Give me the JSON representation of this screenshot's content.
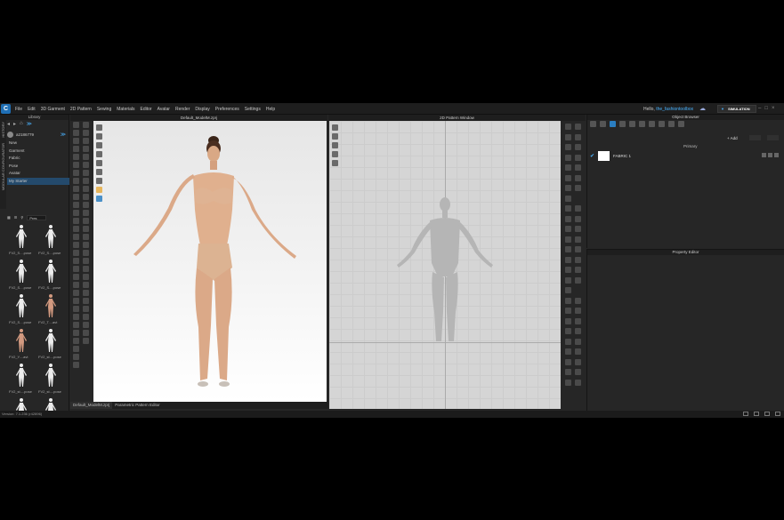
{
  "app": {
    "menu": [
      "File",
      "Edit",
      "3D Garment",
      "2D Pattern",
      "Sewing",
      "Materials",
      "Editor",
      "Avatar",
      "Render",
      "Display",
      "Preferences",
      "Settings",
      "Help"
    ],
    "greeting": "Hello,",
    "username": "the_fashiontoolbox",
    "mode_label": "SIMULATION"
  },
  "library": {
    "title": "Library",
    "vtabs": [
      "HISTORY",
      "MODULAR CONFIGURATOR"
    ],
    "user_id": "a2186779",
    "items": [
      "New",
      "Garment",
      "Fabric",
      "Pose",
      "Avatar",
      "My Starter"
    ],
    "selected_index": 5,
    "filter_label": "Pres",
    "thumbs": [
      {
        "cap": "FV2_S....pose",
        "skin": false
      },
      {
        "cap": "FV2_S....pose",
        "skin": false
      },
      {
        "cap": "FV2_S....pose",
        "skin": false
      },
      {
        "cap": "FV2_S....pose",
        "skin": false
      },
      {
        "cap": "FV2_S....pose",
        "skin": false
      },
      {
        "cap": "FV2_T....avt",
        "skin": true
      },
      {
        "cap": "FV2_Y....avt",
        "skin": true
      },
      {
        "cap": "FV2_st....pose",
        "skin": false
      },
      {
        "cap": "FV2_st....pose",
        "skin": false
      },
      {
        "cap": "FV2_st....pose",
        "skin": false
      },
      {
        "cap": "",
        "skin": false
      },
      {
        "cap": "",
        "skin": false
      }
    ]
  },
  "viewport3d": {
    "title": "Default_ModelM.zprj",
    "tabs": [
      "Default_ModelM.zprj",
      "Parametric Pattern Editor"
    ]
  },
  "viewport2d": {
    "title": "2D Pattern Window"
  },
  "object_browser": {
    "title": "Object Browser",
    "add_label": "+ Add",
    "column_header": "Primary",
    "fabric_name": "FABRIC 1",
    "fabric_color": "#ffffff"
  },
  "property_editor": {
    "title": "Property Editor"
  },
  "status": {
    "version": "Version: 7.1.236 (r42896)"
  },
  "colors": {
    "accent": "#2b7ec1",
    "username": "#4ab3ff"
  }
}
